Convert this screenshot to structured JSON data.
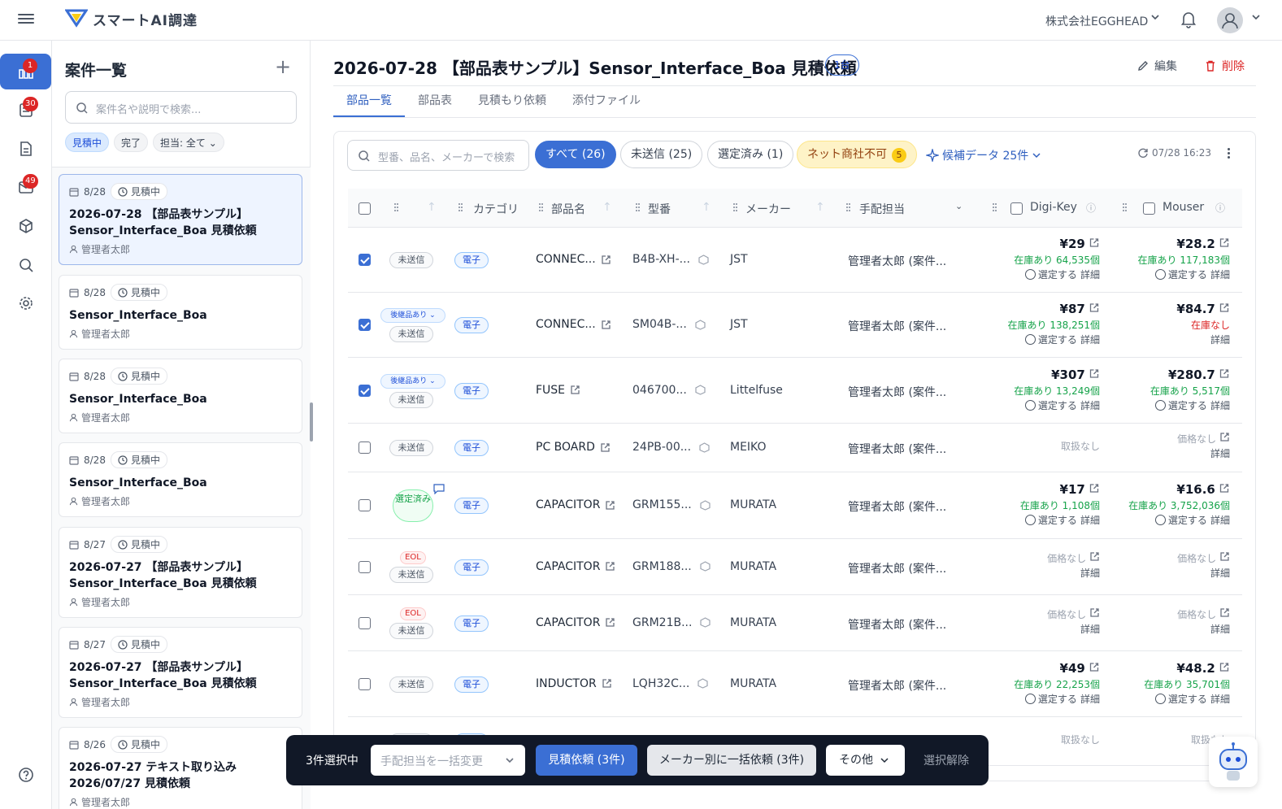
{
  "app": {
    "name": "スマートAI調達",
    "company": "株式会社EGGHEAD"
  },
  "rail": {
    "badges": {
      "projects": "1",
      "parts": "30",
      "inbox": "49"
    }
  },
  "sidebar": {
    "title": "案件一覧",
    "search_placeholder": "案件名や説明で検索...",
    "filters": [
      "見積中",
      "完了",
      "担当: 全て"
    ],
    "cards": [
      {
        "date": "8/28",
        "status": "見積中",
        "title": "2026-07-28 【部品表サンプル】Sensor_Interface_Boa 見積依頼",
        "user": "管理者太郎"
      },
      {
        "date": "8/28",
        "status": "見積中",
        "title": "Sensor_Interface_Boa",
        "user": "管理者太郎"
      },
      {
        "date": "8/28",
        "status": "見積中",
        "title": "Sensor_Interface_Boa",
        "user": "管理者太郎"
      },
      {
        "date": "8/28",
        "status": "見積中",
        "title": "Sensor_Interface_Boa",
        "user": "管理者太郎"
      },
      {
        "date": "8/27",
        "status": "見積中",
        "title": "2026-07-27 【部品表サンプル】Sensor_Interface_Boa 見積依頼",
        "user": "管理者太郎"
      },
      {
        "date": "8/27",
        "status": "見積中",
        "title": "2026-07-27 【部品表サンプル】Sensor_Interface_Boa 見積依頼",
        "user": "管理者太郎"
      },
      {
        "date": "8/26",
        "status": "見積中",
        "title": "2026-07-27 テキスト取り込み 2026/07/27 見積依頼",
        "user": "管理者太郎"
      }
    ]
  },
  "main": {
    "title": "2026-07-28 【部品表サンプル】Sensor_Interface_Boa 見積依頼",
    "badge": "1台",
    "edit": "編集",
    "delete": "削除",
    "tabs": [
      "部品一覧",
      "部品表",
      "見積もり依頼",
      "添付ファイル"
    ],
    "search_placeholder": "型番、品名、メーカーで検索",
    "filters": {
      "all": "すべて (26)",
      "unsent": "未送信 (25)",
      "selected": "選定済み (1)",
      "ng": "ネット商社不可",
      "ng_count": "5"
    },
    "candidates": "候補データ 25件",
    "synced": "07/28 16:23",
    "columns": {
      "category": "カテゴリ",
      "part": "部品名",
      "mpn": "型番",
      "maker": "メーカー",
      "assignee": "手配担当",
      "digikey": "Digi-Key",
      "mouser": "Mouser"
    },
    "rows": [
      {
        "checked": true,
        "status": "未送信",
        "cat": "電子",
        "part": "CONNEC...",
        "mpn": "B4B-XH-...",
        "maker": "JST",
        "assignee": "管理者太郎 (案件...",
        "dk": {
          "price": "¥29",
          "stock": "在庫あり 64,535個",
          "sel": "選定する",
          "det": "詳細"
        },
        "mo": {
          "price": "¥28.2",
          "stock": "在庫あり 117,183個",
          "sel": "選定する",
          "det": "詳細"
        }
      },
      {
        "checked": true,
        "succ": "後継品あり",
        "status": "未送信",
        "cat": "電子",
        "part": "CONNEC...",
        "mpn": "SM04B-...",
        "maker": "JST",
        "assignee": "管理者太郎 (案件...",
        "dk": {
          "price": "¥87",
          "stock": "在庫あり 138,251個",
          "sel": "選定する",
          "det": "詳細"
        },
        "mo": {
          "price": "¥84.7",
          "none": "在庫なし",
          "det": "詳細"
        }
      },
      {
        "checked": true,
        "succ": "後継品あり",
        "status": "未送信",
        "cat": "電子",
        "part": "FUSE",
        "mpn": "046700...",
        "maker": "Littelfuse",
        "assignee": "管理者太郎 (案件...",
        "dk": {
          "price": "¥307",
          "stock": "在庫あり 13,249個",
          "sel": "選定する",
          "det": "詳細"
        },
        "mo": {
          "price": "¥280.7",
          "stock": "在庫あり 5,517個",
          "sel": "選定する",
          "det": "詳細"
        }
      },
      {
        "checked": false,
        "status": "未送信",
        "cat": "電子",
        "part": "PC BOARD",
        "mpn": "24PB-00...",
        "maker": "MEIKO",
        "assignee": "管理者太郎 (案件...",
        "dk": {
          "gray": "取扱なし"
        },
        "mo": {
          "gray": "価格なし",
          "det": "詳細"
        }
      },
      {
        "checked": false,
        "status": "選定済み",
        "cat": "電子",
        "part": "CAPACITOR",
        "mpn": "GRM155...",
        "maker": "MURATA",
        "assignee": "管理者太郎 (案件...",
        "dk": {
          "price": "¥17",
          "stock": "在庫あり 1,108個",
          "sel": "選定する",
          "det": "詳細"
        },
        "mo": {
          "price": "¥16.6",
          "stock": "在庫あり 3,752,036個",
          "sel": "選定する",
          "det": "詳細"
        }
      },
      {
        "checked": false,
        "eol": "EOL",
        "status": "未送信",
        "cat": "電子",
        "part": "CAPACITOR",
        "mpn": "GRM188...",
        "maker": "MURATA",
        "assignee": "管理者太郎 (案件...",
        "dk": {
          "gray": "価格なし",
          "det": "詳細"
        },
        "mo": {
          "gray": "価格なし",
          "det": "詳細"
        }
      },
      {
        "checked": false,
        "eol": "EOL",
        "status": "未送信",
        "cat": "電子",
        "part": "CAPACITOR",
        "mpn": "GRM21B...",
        "maker": "MURATA",
        "assignee": "管理者太郎 (案件...",
        "dk": {
          "gray": "価格なし",
          "det": "詳細"
        },
        "mo": {
          "gray": "価格なし",
          "det": "詳細"
        }
      },
      {
        "checked": false,
        "status": "未送信",
        "cat": "電子",
        "part": "INDUCTOR",
        "mpn": "LQH32C...",
        "maker": "MURATA",
        "assignee": "管理者太郎 (案件...",
        "dk": {
          "price": "¥49",
          "stock": "在庫あり 22,253個",
          "sel": "選定する",
          "det": "詳細"
        },
        "mo": {
          "price": "¥48.2",
          "stock": "在庫あり 35,701個",
          "sel": "選定する",
          "det": "詳細"
        }
      },
      {
        "checked": false,
        "status": "未送信",
        "cat": "電子",
        "part": "",
        "mpn": "",
        "maker": "",
        "assignee": "管理者太郎 (案件...",
        "dk": {
          "gray": "取扱なし"
        },
        "mo": {
          "gray": "取扱なし"
        }
      }
    ]
  },
  "bulkbar": {
    "selected": "3件選択中",
    "assignee_placeholder": "手配担当を一括変更",
    "request": "見積依頼 (3件)",
    "by_maker": "メーカー別に一括依頼 (3件)",
    "other": "その他",
    "clear": "選択解除"
  }
}
